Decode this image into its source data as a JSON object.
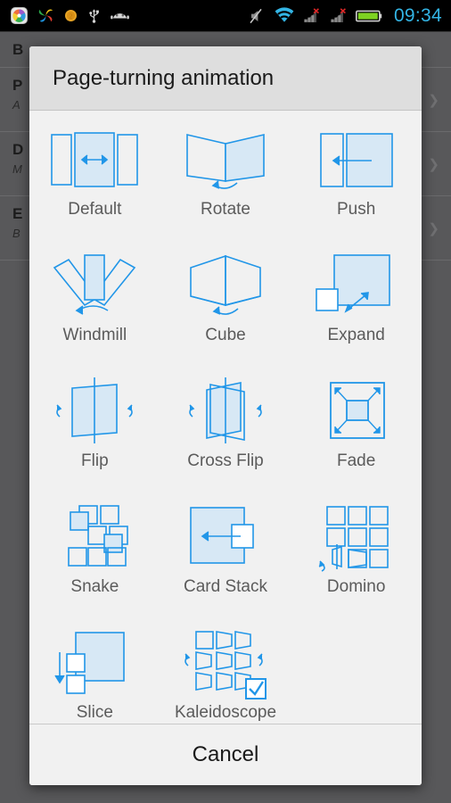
{
  "statusbar": {
    "clock": "09:34",
    "left_icons": [
      {
        "name": "app-icon-colorful",
        "label": "app"
      },
      {
        "name": "app-icon-pinwheel",
        "label": "pinwheel"
      },
      {
        "name": "coin-icon",
        "label": "coin"
      },
      {
        "name": "usb-icon",
        "label": "usb"
      },
      {
        "name": "android-icon",
        "label": "android"
      }
    ],
    "right_icons": [
      {
        "name": "volume-mute-icon",
        "label": "muted"
      },
      {
        "name": "wifi-icon",
        "label": "wifi"
      },
      {
        "name": "signal-sim1-no-service-icon",
        "label": "no service"
      },
      {
        "name": "signal-sim2-no-service-icon",
        "label": "no service"
      },
      {
        "name": "battery-icon",
        "label": "battery"
      }
    ]
  },
  "background_list": [
    {
      "title": "B",
      "sub": ""
    },
    {
      "title": "P",
      "sub": "A"
    },
    {
      "title": "D",
      "sub": "M"
    },
    {
      "title": "E",
      "sub": "B"
    }
  ],
  "dialog": {
    "title": "Page-turning animation",
    "cancel_label": "Cancel",
    "accent": "#2196e8",
    "fill": "#d7e8f5",
    "label_color": "#5b5b5b",
    "header_bg": "#dedede",
    "body_bg": "#f1f1f1",
    "selected": "Kaleidoscope",
    "options": [
      {
        "label": "Default",
        "icon": "default-animation-icon",
        "selected": false
      },
      {
        "label": "Rotate",
        "icon": "rotate-animation-icon",
        "selected": false
      },
      {
        "label": "Push",
        "icon": "push-animation-icon",
        "selected": false
      },
      {
        "label": "Windmill",
        "icon": "windmill-animation-icon",
        "selected": false
      },
      {
        "label": "Cube",
        "icon": "cube-animation-icon",
        "selected": false
      },
      {
        "label": "Expand",
        "icon": "expand-animation-icon",
        "selected": false
      },
      {
        "label": "Flip",
        "icon": "flip-animation-icon",
        "selected": false
      },
      {
        "label": "Cross Flip",
        "icon": "cross-flip-animation-icon",
        "selected": false
      },
      {
        "label": "Fade",
        "icon": "fade-animation-icon",
        "selected": false
      },
      {
        "label": "Snake",
        "icon": "snake-animation-icon",
        "selected": false
      },
      {
        "label": "Card Stack",
        "icon": "card-stack-animation-icon",
        "selected": false
      },
      {
        "label": "Domino",
        "icon": "domino-animation-icon",
        "selected": false
      },
      {
        "label": "Slice",
        "icon": "slice-animation-icon",
        "selected": false
      },
      {
        "label": "Kaleidoscope",
        "icon": "kaleidoscope-animation-icon",
        "selected": true
      }
    ]
  }
}
